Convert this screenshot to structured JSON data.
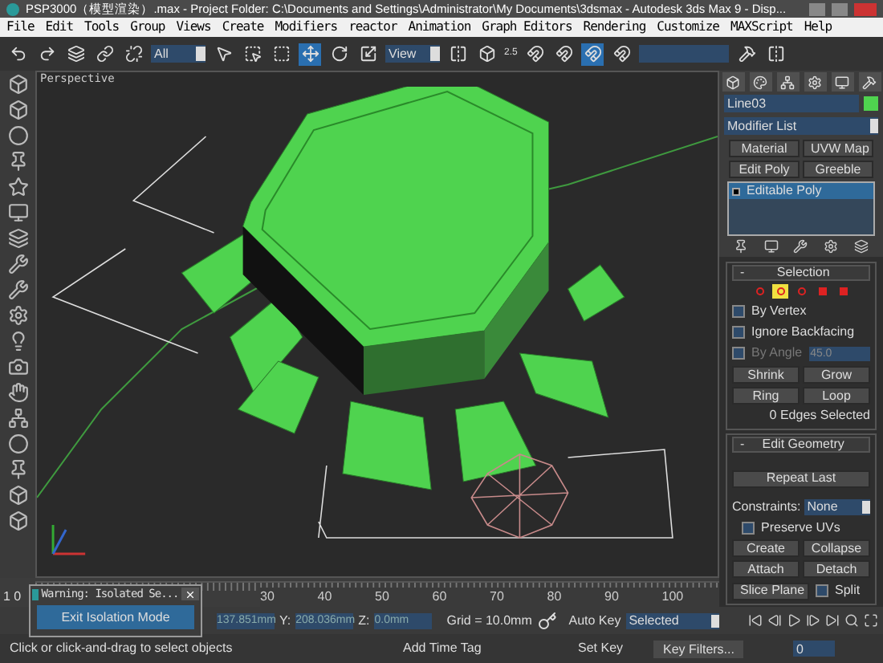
{
  "window": {
    "title": "PSP3000（模型渲染）.max    - Project Folder: C:\\Documents and Settings\\Administrator\\My Documents\\3dsmax    - Autodesk 3ds Max 9    - Disp..."
  },
  "menu": [
    "File",
    "Edit",
    "Tools",
    "Group",
    "Views",
    "Create",
    "Modifiers",
    "reactor",
    "Animation",
    "Graph Editors",
    "Rendering",
    "Customize",
    "MAXScript",
    "Help"
  ],
  "toolbar": {
    "selection_filter": "All",
    "reference_coord": "View",
    "angle_snap_label": "2.5",
    "tools": [
      {
        "selected": false
      },
      {
        "selected": false
      },
      {
        "selected": false
      },
      {
        "selected": false
      },
      {
        "selected": false
      },
      {
        "selected": false
      },
      {
        "selected": false
      },
      {
        "selected": false
      },
      {
        "selected": true
      },
      {
        "selected": false
      },
      {
        "selected": false
      },
      {
        "selected": false
      },
      {
        "selected": false
      },
      {
        "selected": false
      },
      {
        "selected": false
      },
      {
        "selected": true
      },
      {
        "selected": false
      },
      {
        "selected": false
      },
      {
        "selected": false
      }
    ]
  },
  "viewport": {
    "label": "Perspective"
  },
  "command_panel": {
    "object_name": "Line03",
    "modifier_list": "Modifier List",
    "modifier_buttons": [
      "Material",
      "UVW Map",
      "Edit Poly",
      "Greeble"
    ],
    "stack": [
      {
        "label": "Editable Poly",
        "selected": true
      }
    ],
    "selection": {
      "title": "Selection",
      "collapse": "-",
      "levels": [
        {
          "selected": false
        },
        {
          "selected": true
        },
        {
          "selected": false
        },
        {
          "selected": false
        },
        {
          "selected": false
        }
      ],
      "by_vertex": {
        "label": "By Vertex",
        "checked": false
      },
      "ignore_backfacing": {
        "label": "Ignore Backfacing",
        "checked": false
      },
      "by_angle": {
        "label": "By Angle",
        "checked": false,
        "disabled": true,
        "value": "45.0"
      },
      "shrink": "Shrink",
      "grow": "Grow",
      "ring": "Ring",
      "loop": "Loop",
      "status": "0 Edges Selected"
    },
    "edit_geometry": {
      "title": "Edit Geometry",
      "collapse": "-",
      "repeat_last": "Repeat Last",
      "constraints_label": "Constraints:",
      "constraints_value": "None",
      "preserve_uvs": {
        "label": "Preserve UVs",
        "checked": false
      },
      "create": "Create",
      "collapse_button": "Collapse",
      "attach": "Attach",
      "detach": "Detach",
      "slice_plane": "Slice Plane",
      "split": {
        "label": "Split",
        "checked": false
      }
    }
  },
  "isolation_dialog": {
    "title": "Warning: Isolated Se...",
    "button": "Exit Isolation Mode"
  },
  "timeline": {
    "frame_partial": "1 0",
    "ticks": [
      "30",
      "40",
      "50",
      "60",
      "70",
      "80",
      "90",
      "100"
    ]
  },
  "coordinates": {
    "x_value": "137.851mm",
    "y_label": "Y:",
    "y_value": "208.036mm",
    "z_label": "Z:",
    "z_value": "0.0mm"
  },
  "grid": "Grid = 10.0mm",
  "add_time_tag": "Add Time Tag",
  "animation": {
    "auto_key": "Auto Key",
    "key_mode": "Selected",
    "set_key": "Set Key",
    "key_filters": "Key Filters...",
    "frame": "0"
  },
  "status_bar": {
    "prompt": "Click or click-and-drag to select objects"
  }
}
